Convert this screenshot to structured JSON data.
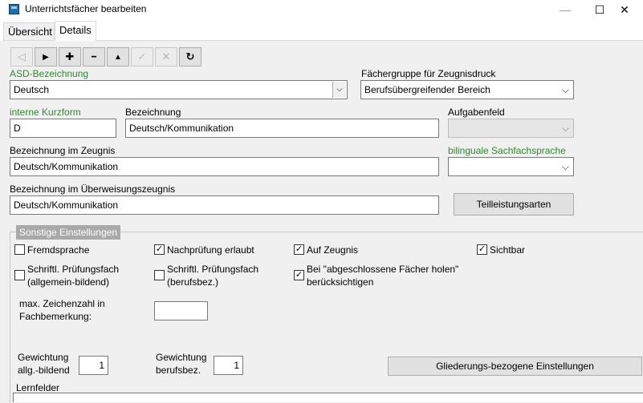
{
  "window": {
    "title": "Unterrichtsfächer bearbeiten",
    "controls": {
      "minimize": "—",
      "maximize": "☐",
      "close": "✕"
    }
  },
  "tabs": [
    {
      "label": "Übersicht",
      "active": false
    },
    {
      "label": "Details",
      "active": true
    }
  ],
  "toolbar": {
    "buttons": [
      {
        "name": "first-record",
        "glyph": "◁",
        "enabled": false
      },
      {
        "name": "next-record",
        "glyph": "▶",
        "enabled": true
      },
      {
        "name": "add-record",
        "glyph": "✚",
        "enabled": true
      },
      {
        "name": "delete-record",
        "glyph": "━",
        "enabled": true
      },
      {
        "name": "move-up",
        "glyph": "▲",
        "enabled": true
      },
      {
        "name": "confirm",
        "glyph": "✓",
        "enabled": false
      },
      {
        "name": "cancel",
        "glyph": "✕",
        "enabled": false
      },
      {
        "name": "refresh",
        "glyph": "↻",
        "enabled": true
      }
    ]
  },
  "form": {
    "asd": {
      "label": "ASD-Bezeichnung",
      "value": "Deutsch"
    },
    "faechergruppe": {
      "label": "Fächergruppe für Zeugnisdruck",
      "value": "Berufsübergreifender Bereich"
    },
    "kurzform": {
      "label": "interne Kurzform",
      "value": "D"
    },
    "bezeichnung": {
      "label": "Bezeichnung",
      "value": "Deutsch/Kommunikation"
    },
    "aufgabenfeld": {
      "label": "Aufgabenfeld",
      "value": ""
    },
    "zeugnis": {
      "label": "Bezeichnung im Zeugnis",
      "value": "Deutsch/Kommunikation"
    },
    "bilingual": {
      "label": "bilinguale Sachfachsprache",
      "value": ""
    },
    "ueberweisung": {
      "label": "Bezeichnung im Überweisungszeugnis",
      "value": "Deutsch/Kommunikation"
    },
    "teilleistungen_button": "Teilleistungsarten"
  },
  "sonstige": {
    "title": "Sonstige Einstellungen",
    "checkboxes": {
      "fremdsprache": {
        "label": "Fremdsprache",
        "checked": false
      },
      "nachpruefung": {
        "label": "Nachprüfung erlaubt",
        "checked": true
      },
      "auf_zeugnis": {
        "label": "Auf Zeugnis",
        "checked": true
      },
      "sichtbar": {
        "label": "Sichtbar",
        "checked": true
      },
      "schriftl_allg": {
        "line1": "Schriftl. Prüfungsfach",
        "line2": "(allgemein-bildend)",
        "checked": false
      },
      "schriftl_beruf": {
        "line1": "Schriftl. Prüfungsfach",
        "line2": "(berufsbez.)",
        "checked": false
      },
      "abgeschlossen": {
        "line1": "Bei \"abgeschlossene Fächer holen\"",
        "line2": "berücksichtigen",
        "checked": true
      }
    },
    "max_zeichen": {
      "line1": "max. Zeichenzahl in",
      "line2": "Fachbemerkung:",
      "value": ""
    },
    "gewichtung_allg": {
      "line1": "Gewichtung",
      "line2": "allg.-bildend",
      "value": "1"
    },
    "gewichtung_beruf": {
      "line1": "Gewichtung",
      "line2": "berufsbez.",
      "value": "1"
    },
    "gliederung_button": "Gliederungs-bezogene Einstellungen",
    "lernfelder_label": "Lernfelder"
  },
  "check_glyph": "✓",
  "dropdown_glyph": "⌵"
}
